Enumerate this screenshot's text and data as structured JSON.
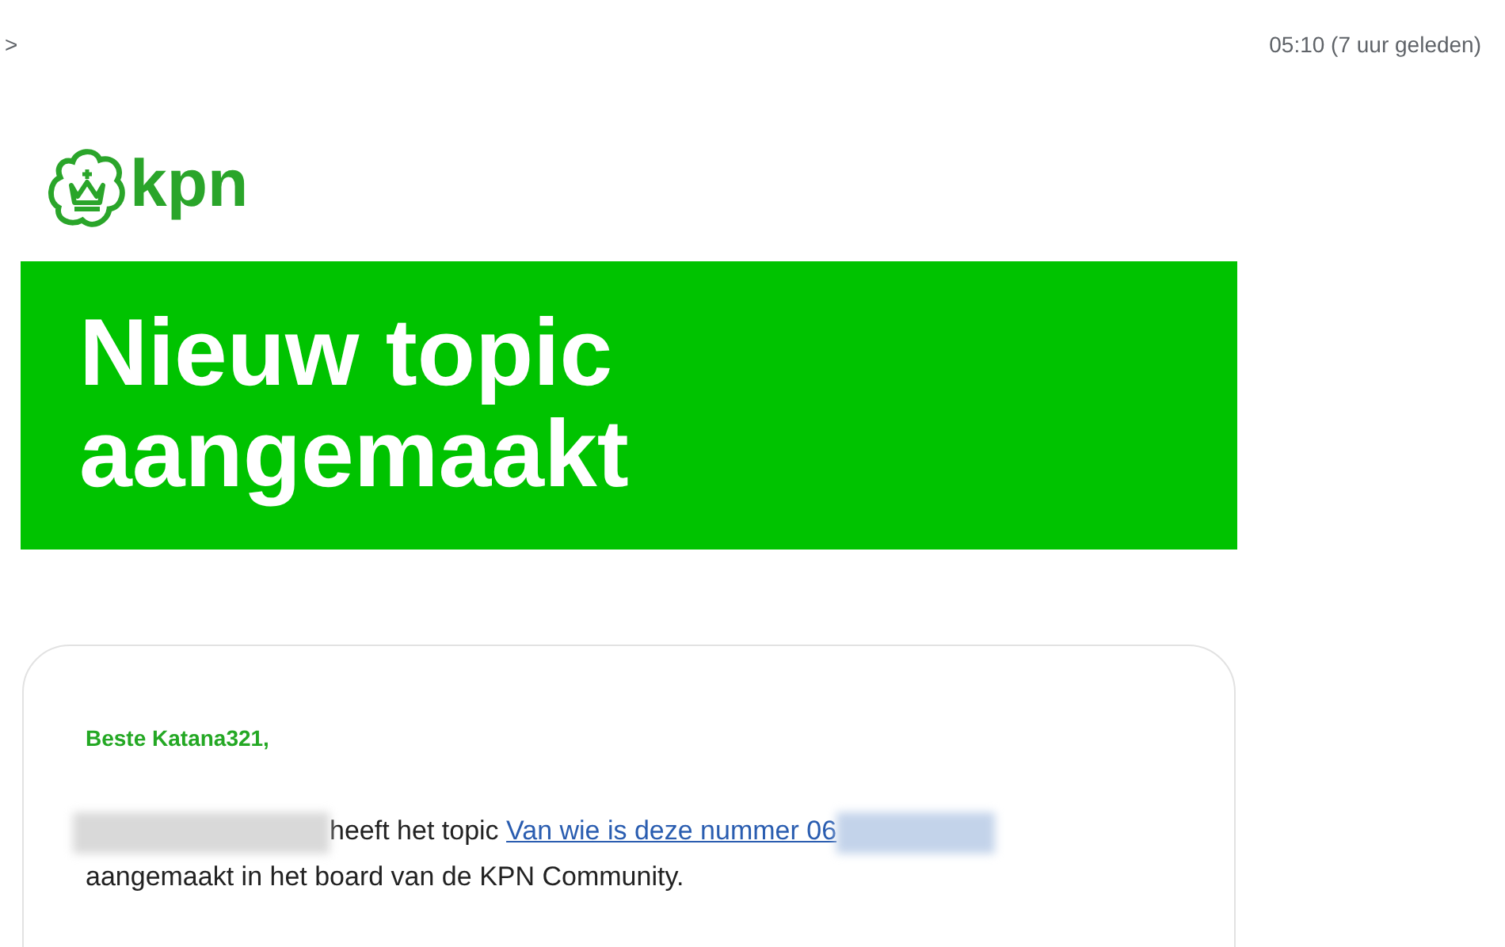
{
  "header": {
    "sender_fragment": ">",
    "time": "05:10 (7 uur geleden)"
  },
  "logo": {
    "wordmark": "kpn"
  },
  "banner": {
    "title_lines": [
      "Nieuw topic",
      "aangemaakt"
    ]
  },
  "card": {
    "greeting": "Beste Katana321,",
    "message": [
      {
        "kind": "redacted"
      },
      {
        "kind": "text",
        "text": "heeft het topic "
      },
      {
        "kind": "link",
        "text": "Van wie is deze nummer 06"
      },
      {
        "kind": "redacted_link"
      },
      {
        "kind": "text",
        "text": " aangemaakt in het board van de KPN Community."
      }
    ]
  }
}
